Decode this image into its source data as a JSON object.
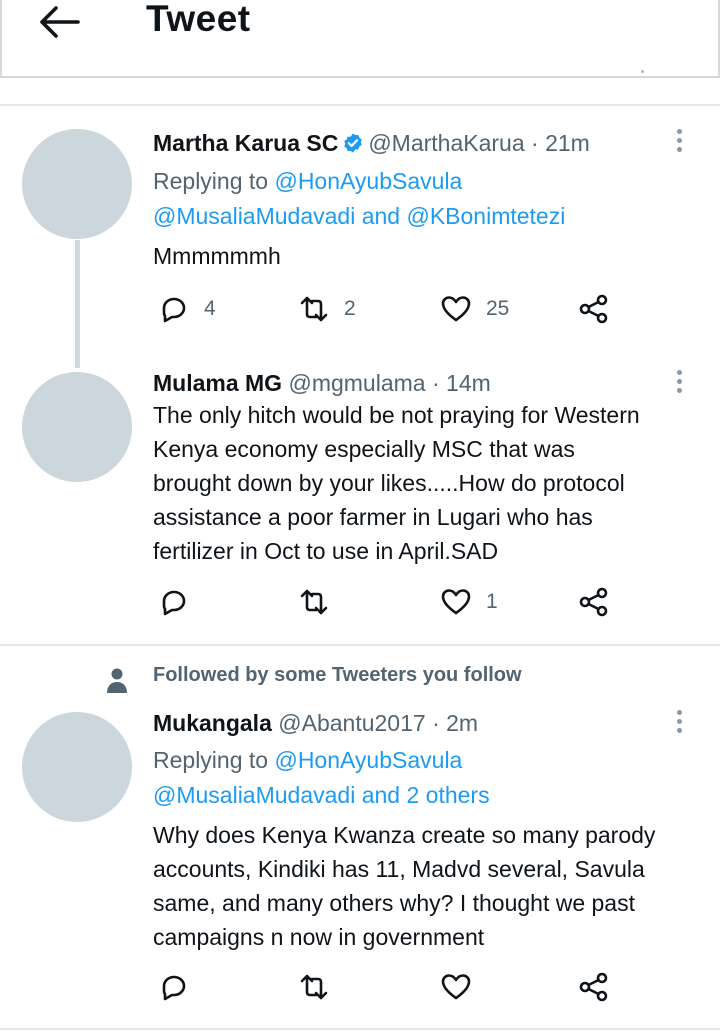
{
  "header": {
    "title": "Tweet"
  },
  "tweets": [
    {
      "name": "Martha Karua SC",
      "verified": true,
      "handle": "@MarthaKarua",
      "sep": " · ",
      "time": "21m",
      "reply_prefix": "Replying to ",
      "reply_line1": "@HonAyubSavula",
      "reply_line2": "@MusaliaMudavadi and @KBonimtetezi",
      "text": "Mmmmmmh",
      "replies": "4",
      "retweets": "2",
      "likes": "25"
    },
    {
      "name": "Mulama MG",
      "handle": "@mgmulama",
      "sep": " · ",
      "time": "14m",
      "text_lines": [
        "The only hitch would be not praying for Western",
        "Kenya economy especially MSC that was",
        "brought down by your likes.....How do protocol",
        "assistance a poor farmer in Lugari who has",
        "fertilizer in Oct to use in April.SAD"
      ],
      "likes": "1"
    },
    {
      "social_context": "Followed by some Tweeters you follow",
      "name": "Mukangala",
      "handle": "@Abantu2017",
      "sep": " · ",
      "time": "2m",
      "reply_prefix": "Replying to ",
      "reply_line1": "@HonAyubSavula",
      "reply_line2": "@MusaliaMudavadi and 2 others",
      "text_lines": [
        "Why does Kenya Kwanza create so many parody",
        "accounts, Kindiki has 11, Madvd several, Savula",
        "same, and many others why? I thought we past",
        "campaigns n now in government"
      ]
    }
  ],
  "icons": {
    "back": "arrow-left-icon",
    "reply": "reply-icon",
    "retweet": "retweet-icon",
    "like": "heart-icon",
    "share": "share-icon",
    "more": "more-vertical-icon",
    "verified": "verified-badge-icon",
    "person": "person-icon"
  },
  "colors": {
    "link": "#1d9bf0",
    "muted": "#536471",
    "avatar": "#ccd6dd",
    "verified": "#1d9bf0"
  }
}
